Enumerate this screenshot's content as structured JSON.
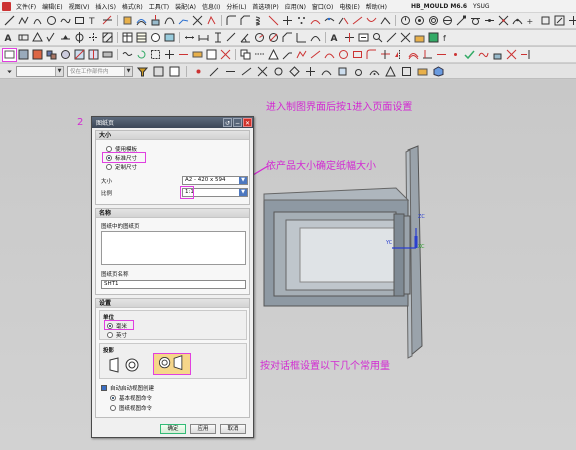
{
  "menubar": {
    "items": [
      "文件(F)",
      "编辑(E)",
      "视图(V)",
      "插入(S)",
      "格式(R)",
      "工具(T)",
      "装配(A)",
      "信息(I)",
      "分析(L)",
      "首选项(P)",
      "应用(N)",
      "窗口(O)",
      "电极(E)",
      "帮助(H)"
    ],
    "app_title": "HB_MOULD M6.6",
    "extra": "YSUG"
  },
  "toolbar4": {
    "filter_placeholder": "仅在工作部件内"
  },
  "annotations": {
    "top": "进入制图界面后按1进入页面设置",
    "size": "依产品大小确定纸幅大小",
    "bottom": "按对话框设置以下几个常用量",
    "step1": "1",
    "step2": "2"
  },
  "dialog": {
    "title": "图纸页",
    "size_section": {
      "heading": "大小",
      "options": [
        "使用模板",
        "标准尺寸",
        "定制尺寸"
      ],
      "selected_index": 1,
      "size_label": "大小",
      "size_value": "A2 - 420 x 594",
      "scale_label": "比例",
      "scale_value": "1:1"
    },
    "name_section": {
      "heading": "名称",
      "list_label": "图纸中的图纸页",
      "sheet_name_label": "图纸页名称",
      "sheet_name_value": "SHT1"
    },
    "settings_section": {
      "heading": "设置",
      "units_label": "单位",
      "units_options": [
        "毫米",
        "英寸"
      ],
      "units_selected": 0,
      "projection_label": "投影",
      "auto_start_label": "自动启动视图创建",
      "view_options": [
        "基本视图命令",
        "图纸视图命令"
      ],
      "view_selected": 0
    },
    "buttons": {
      "ok": "确定",
      "apply": "应用",
      "cancel": "取消"
    }
  },
  "model": {
    "axis_zc": "ZC",
    "axis_yc": "YC",
    "axis_xc": "XC"
  },
  "colors": {
    "annotation": "#d22ad2",
    "titlebar": "#3b4656",
    "close_button": "#d0322a",
    "model_gray": "#8f9aa4"
  }
}
